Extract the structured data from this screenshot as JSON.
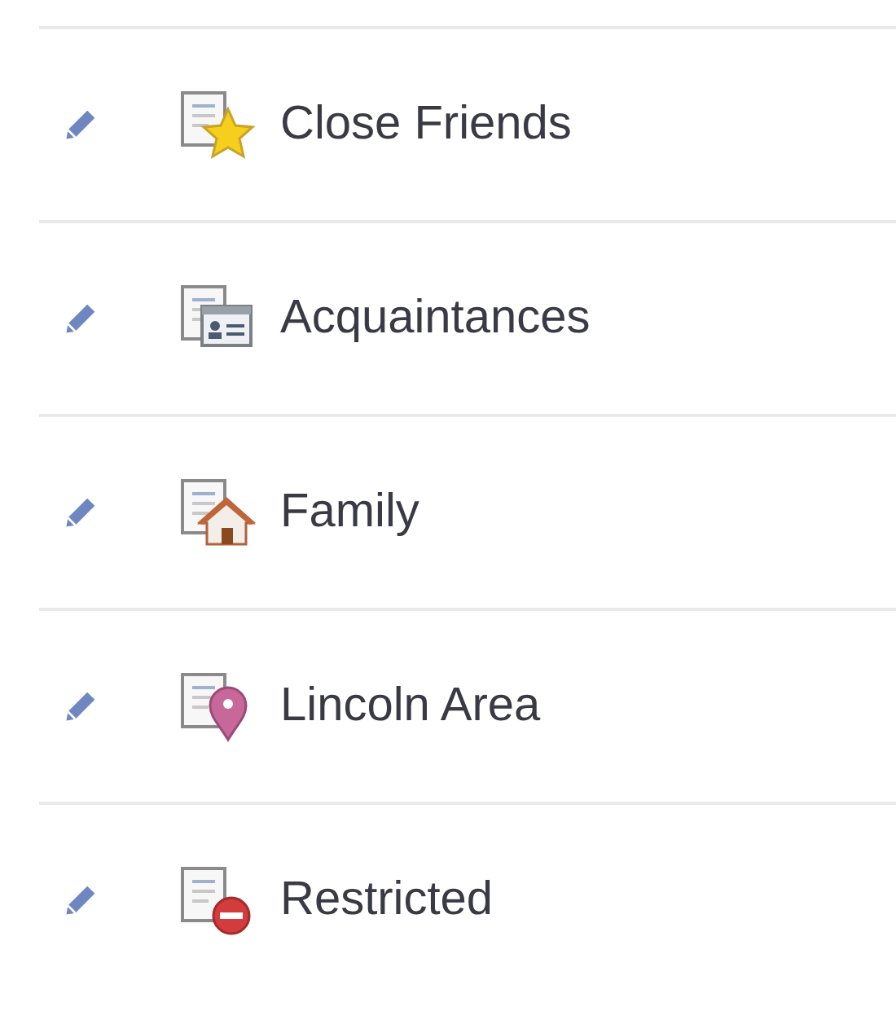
{
  "lists": [
    {
      "kind": "star",
      "label": "Close Friends"
    },
    {
      "kind": "contact",
      "label": "Acquaintances"
    },
    {
      "kind": "home",
      "label": "Family"
    },
    {
      "kind": "pin",
      "label": "Lincoln Area"
    },
    {
      "kind": "blocked",
      "label": "Restricted"
    }
  ]
}
